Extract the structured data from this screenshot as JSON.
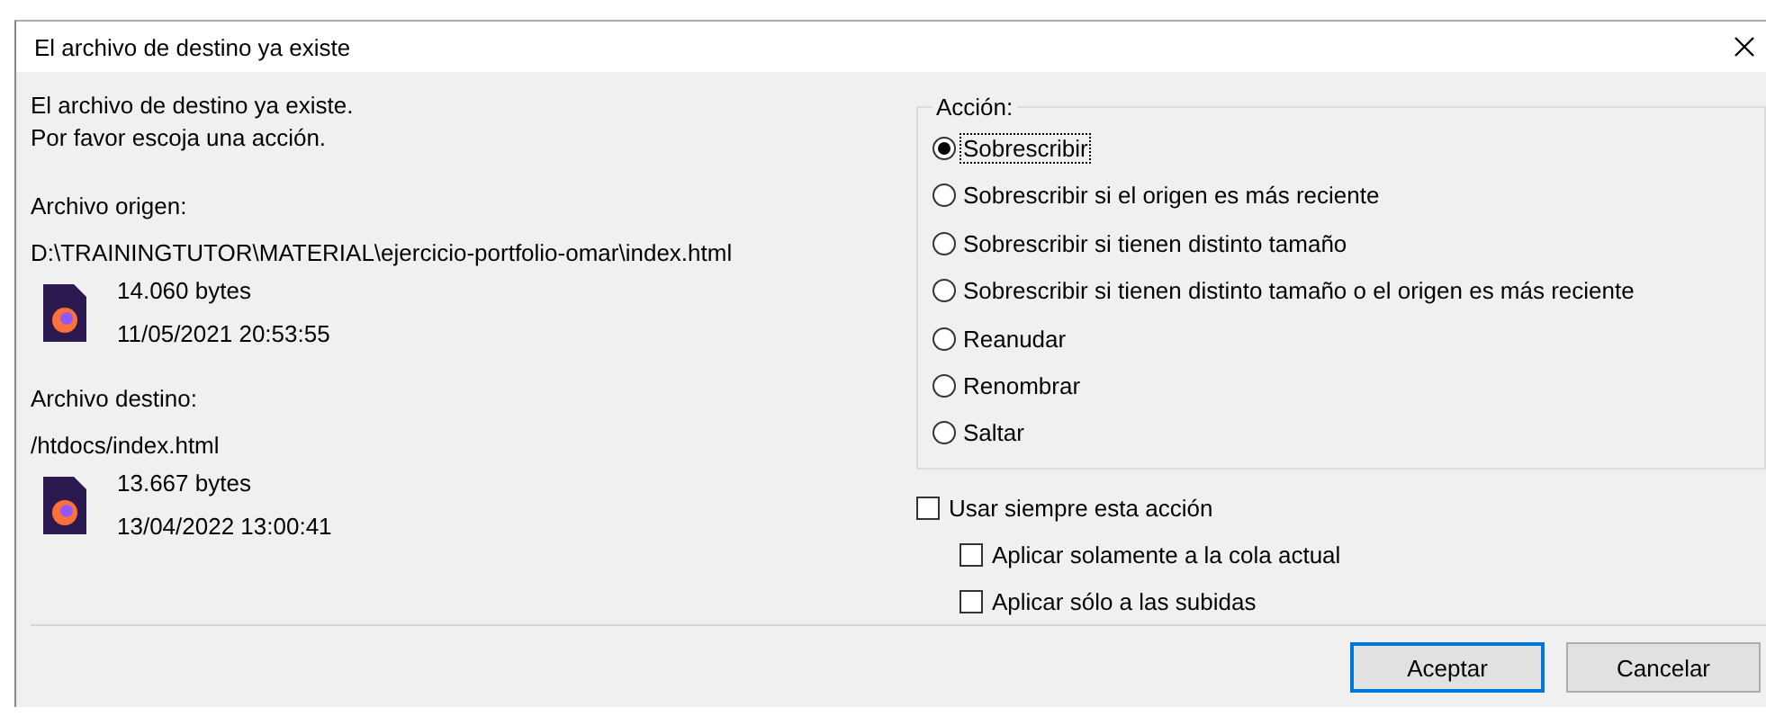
{
  "window": {
    "title": "El archivo de destino ya existe"
  },
  "message": [
    "El archivo de destino ya existe.",
    "Por favor escoja una acción."
  ],
  "files": [
    {
      "label": "Archivo origen:",
      "path": "D:\\TRAININGTUTOR\\MATERIAL\\ejercicio-portfolio-omar\\index.html",
      "size": "14.060 bytes",
      "date": "11/05/2021 20:53:55"
    },
    {
      "label": "Archivo destino:",
      "path": "/htdocs/index.html",
      "size": "13.667 bytes",
      "date": "13/04/2022 13:00:41"
    }
  ],
  "action_group": {
    "title": "Acción:",
    "options": [
      {
        "label": "Sobrescribir",
        "selected": true
      },
      {
        "label": "Sobrescribir si el origen es más reciente",
        "selected": false
      },
      {
        "label": "Sobrescribir si tienen distinto tamaño",
        "selected": false
      },
      {
        "label": "Sobrescribir si tienen distinto tamaño o el origen es más reciente",
        "selected": false
      },
      {
        "label": "Reanudar",
        "selected": false
      },
      {
        "label": "Renombrar",
        "selected": false
      },
      {
        "label": "Saltar",
        "selected": false
      }
    ]
  },
  "checkboxes": [
    {
      "label": "Usar siempre esta acción",
      "checked": false,
      "kind": "main"
    },
    {
      "label": "Aplicar solamente a la cola actual",
      "checked": false,
      "kind": "sub"
    },
    {
      "label": "Aplicar sólo a las subidas",
      "checked": false,
      "kind": "sub"
    }
  ],
  "buttons": [
    {
      "label": "Aceptar",
      "default": true
    },
    {
      "label": "Cancelar",
      "default": false
    }
  ]
}
